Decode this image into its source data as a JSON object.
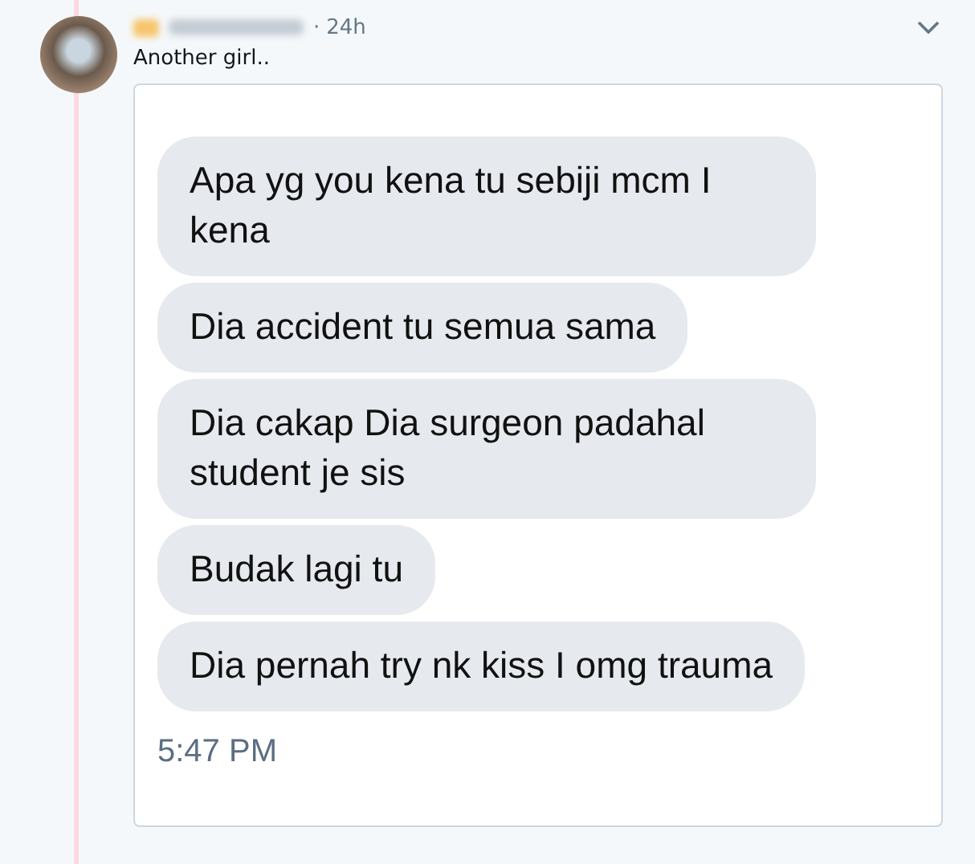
{
  "tweet": {
    "separator": "·",
    "time": "24h",
    "text": "Another girl..",
    "chat": {
      "messages": [
        {
          "text": "Apa yg you kena tu sebiji mcm I kena"
        },
        {
          "text": "Dia accident tu semua sama"
        },
        {
          "text": "Dia cakap Dia surgeon padahal student je sis"
        },
        {
          "text": "Budak lagi tu"
        },
        {
          "text": "Dia pernah try nk kiss I omg trauma"
        }
      ],
      "timestamp": "5:47 PM"
    }
  }
}
